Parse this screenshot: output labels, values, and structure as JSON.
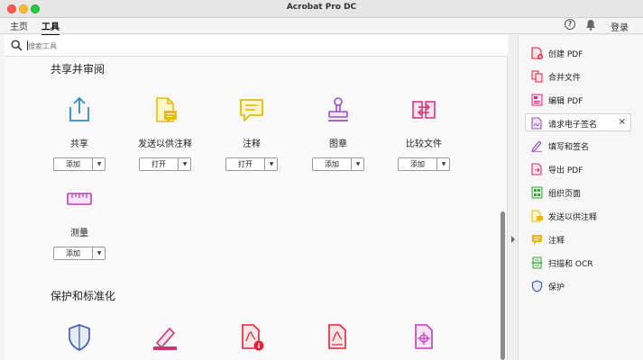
{
  "window": {
    "title": "Acrobat Pro DC"
  },
  "menu": {
    "home": "主页",
    "tools": "工具",
    "login": "登录"
  },
  "search": {
    "placeholder": "搜索工具"
  },
  "sections": [
    {
      "title": "共享并审阅"
    },
    {
      "title": "保护和标准化"
    }
  ],
  "tools": [
    {
      "label": "共享",
      "button": "添加",
      "icon": "share-icon",
      "color": "#2d8ac9"
    },
    {
      "label": "发送以供注释",
      "button": "打开",
      "icon": "send-for-comment-icon",
      "color": "#e8b912"
    },
    {
      "label": "注释",
      "button": "打开",
      "icon": "comment-icon",
      "color": "#e8b912"
    },
    {
      "label": "图章",
      "button": "添加",
      "icon": "stamp-icon",
      "color": "#9b4fc2"
    },
    {
      "label": "比较文件",
      "button": "添加",
      "icon": "compare-files-icon",
      "color": "#d4317a"
    },
    {
      "label": "测量",
      "button": "添加",
      "icon": "measure-icon",
      "color": "#c03cc0"
    }
  ],
  "protect_icons": [
    "protect-shield-icon",
    "redact-icon",
    "pdf-standards-icon",
    "certificates-icon",
    "print-production-icon"
  ],
  "right_panel": {
    "items": [
      {
        "label": "创建 PDF",
        "icon": "create-pdf-icon",
        "color": "#e2213b"
      },
      {
        "label": "合并文件",
        "icon": "combine-files-icon",
        "color": "#e2213b"
      },
      {
        "label": "编辑 PDF",
        "icon": "edit-pdf-icon",
        "color": "#d4317a"
      },
      {
        "label": "请求电子签名",
        "icon": "request-signature-icon",
        "color": "#9b4fc2",
        "selected": true
      },
      {
        "label": "填写和签名",
        "icon": "fill-sign-icon",
        "color": "#9b4fc2"
      },
      {
        "label": "导出 PDF",
        "icon": "export-pdf-icon",
        "color": "#d4317a"
      },
      {
        "label": "组织页面",
        "icon": "organize-pages-icon",
        "color": "#3aa33a"
      },
      {
        "label": "发送以供注释",
        "icon": "send-for-comment-icon",
        "color": "#e8b912"
      },
      {
        "label": "注释",
        "icon": "comment-icon",
        "color": "#e8b912"
      },
      {
        "label": "扫描和 OCR",
        "icon": "scan-ocr-icon",
        "color": "#3aa33a"
      },
      {
        "label": "保护",
        "icon": "protect-icon",
        "color": "#3b55a8"
      }
    ],
    "close_glyph": "×"
  }
}
